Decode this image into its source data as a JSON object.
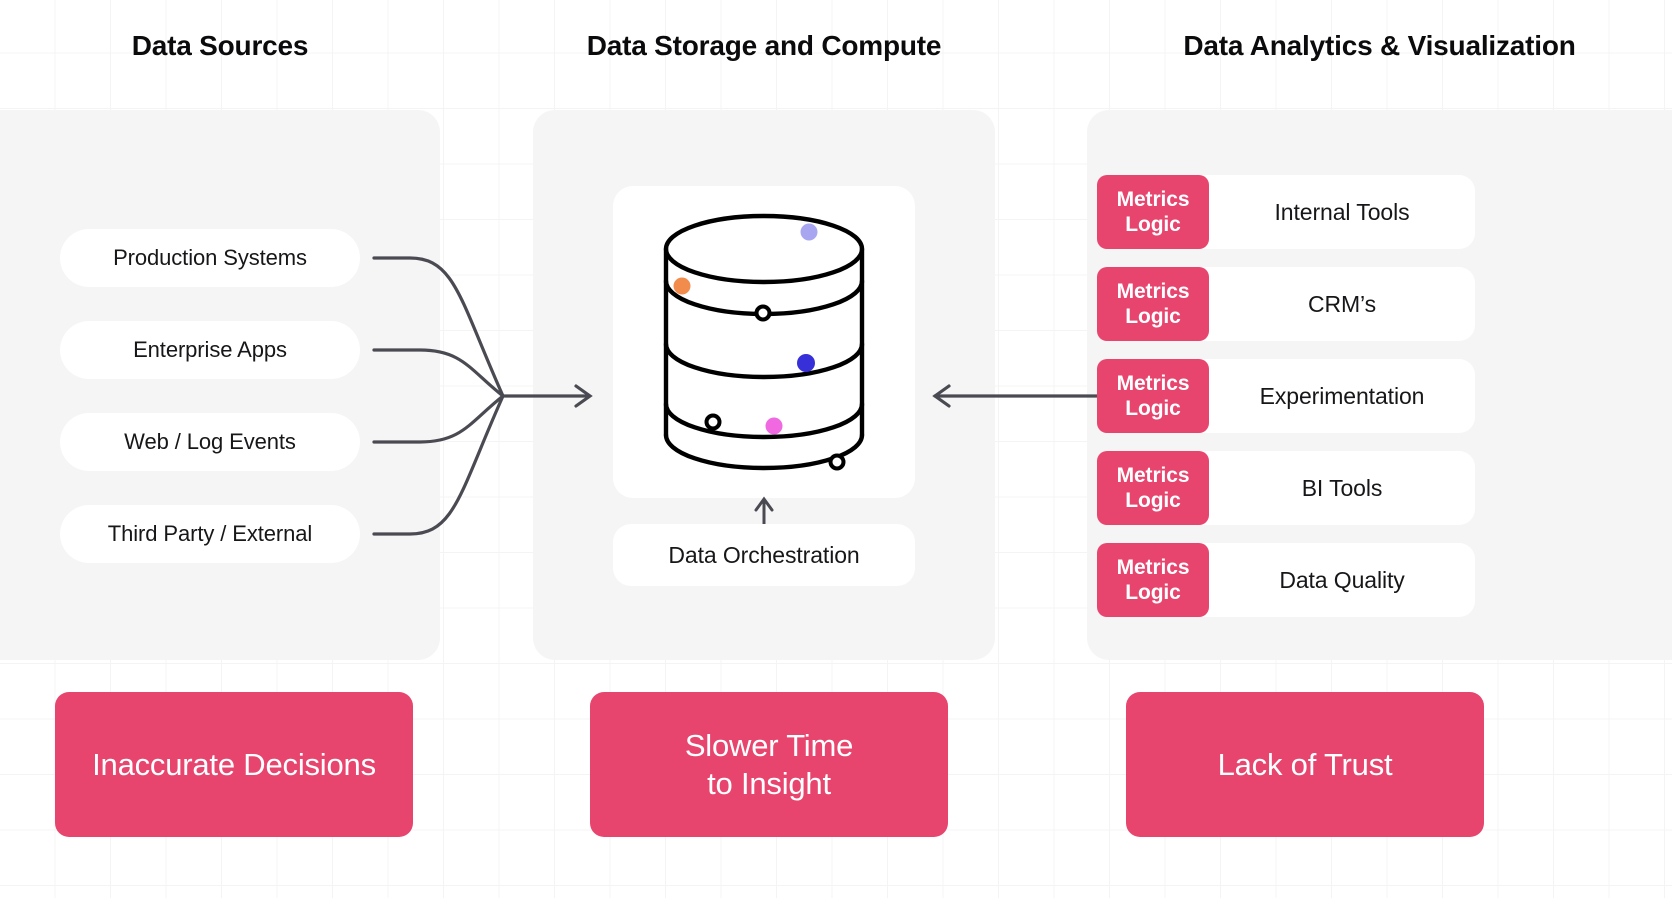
{
  "columns": {
    "sources_title": "Data Sources",
    "storage_title": "Data Storage and Compute",
    "analytics_title": "Data Analytics & Visualization"
  },
  "sources": {
    "items": [
      {
        "label": "Production Systems"
      },
      {
        "label": "Enterprise Apps"
      },
      {
        "label": "Web / Log Events"
      },
      {
        "label": "Third Party / External"
      }
    ]
  },
  "storage": {
    "database_label": "database-cylinder",
    "orchestration_label": "Data Orchestration",
    "dots": [
      {
        "name": "periwinkle-dot",
        "color": "#a8a6f0"
      },
      {
        "name": "orange-dot",
        "color": "#f28c4c"
      },
      {
        "name": "blue-dot",
        "color": "#3730d9"
      },
      {
        "name": "magenta-dot",
        "color": "#f069e0"
      },
      {
        "name": "hollow-dot-top",
        "color": "#ffffff"
      },
      {
        "name": "hollow-dot-mid",
        "color": "#ffffff"
      },
      {
        "name": "hollow-dot-bottom",
        "color": "#ffffff"
      }
    ]
  },
  "analytics": {
    "badge_line1": "Metrics",
    "badge_line2": "Logic",
    "rows": [
      {
        "label": "Internal Tools"
      },
      {
        "label": "CRM’s"
      },
      {
        "label": "Experimentation"
      },
      {
        "label": "BI Tools"
      },
      {
        "label": "Data Quality"
      }
    ]
  },
  "outcomes": [
    {
      "name": "inaccurate-decisions",
      "label": "Inaccurate Decisions"
    },
    {
      "name": "slower-time-to-insight",
      "label": "Slower Time\nto Insight"
    },
    {
      "name": "lack-of-trust",
      "label": "Lack of Trust"
    }
  ],
  "colors": {
    "accent_pink": "#e8456e",
    "panel_grey": "#f5f5f6",
    "card_white": "#ffffff",
    "text_dark": "#17171a",
    "connector_grey": "#4a4a52",
    "grid_line": "#f4f4f5"
  }
}
